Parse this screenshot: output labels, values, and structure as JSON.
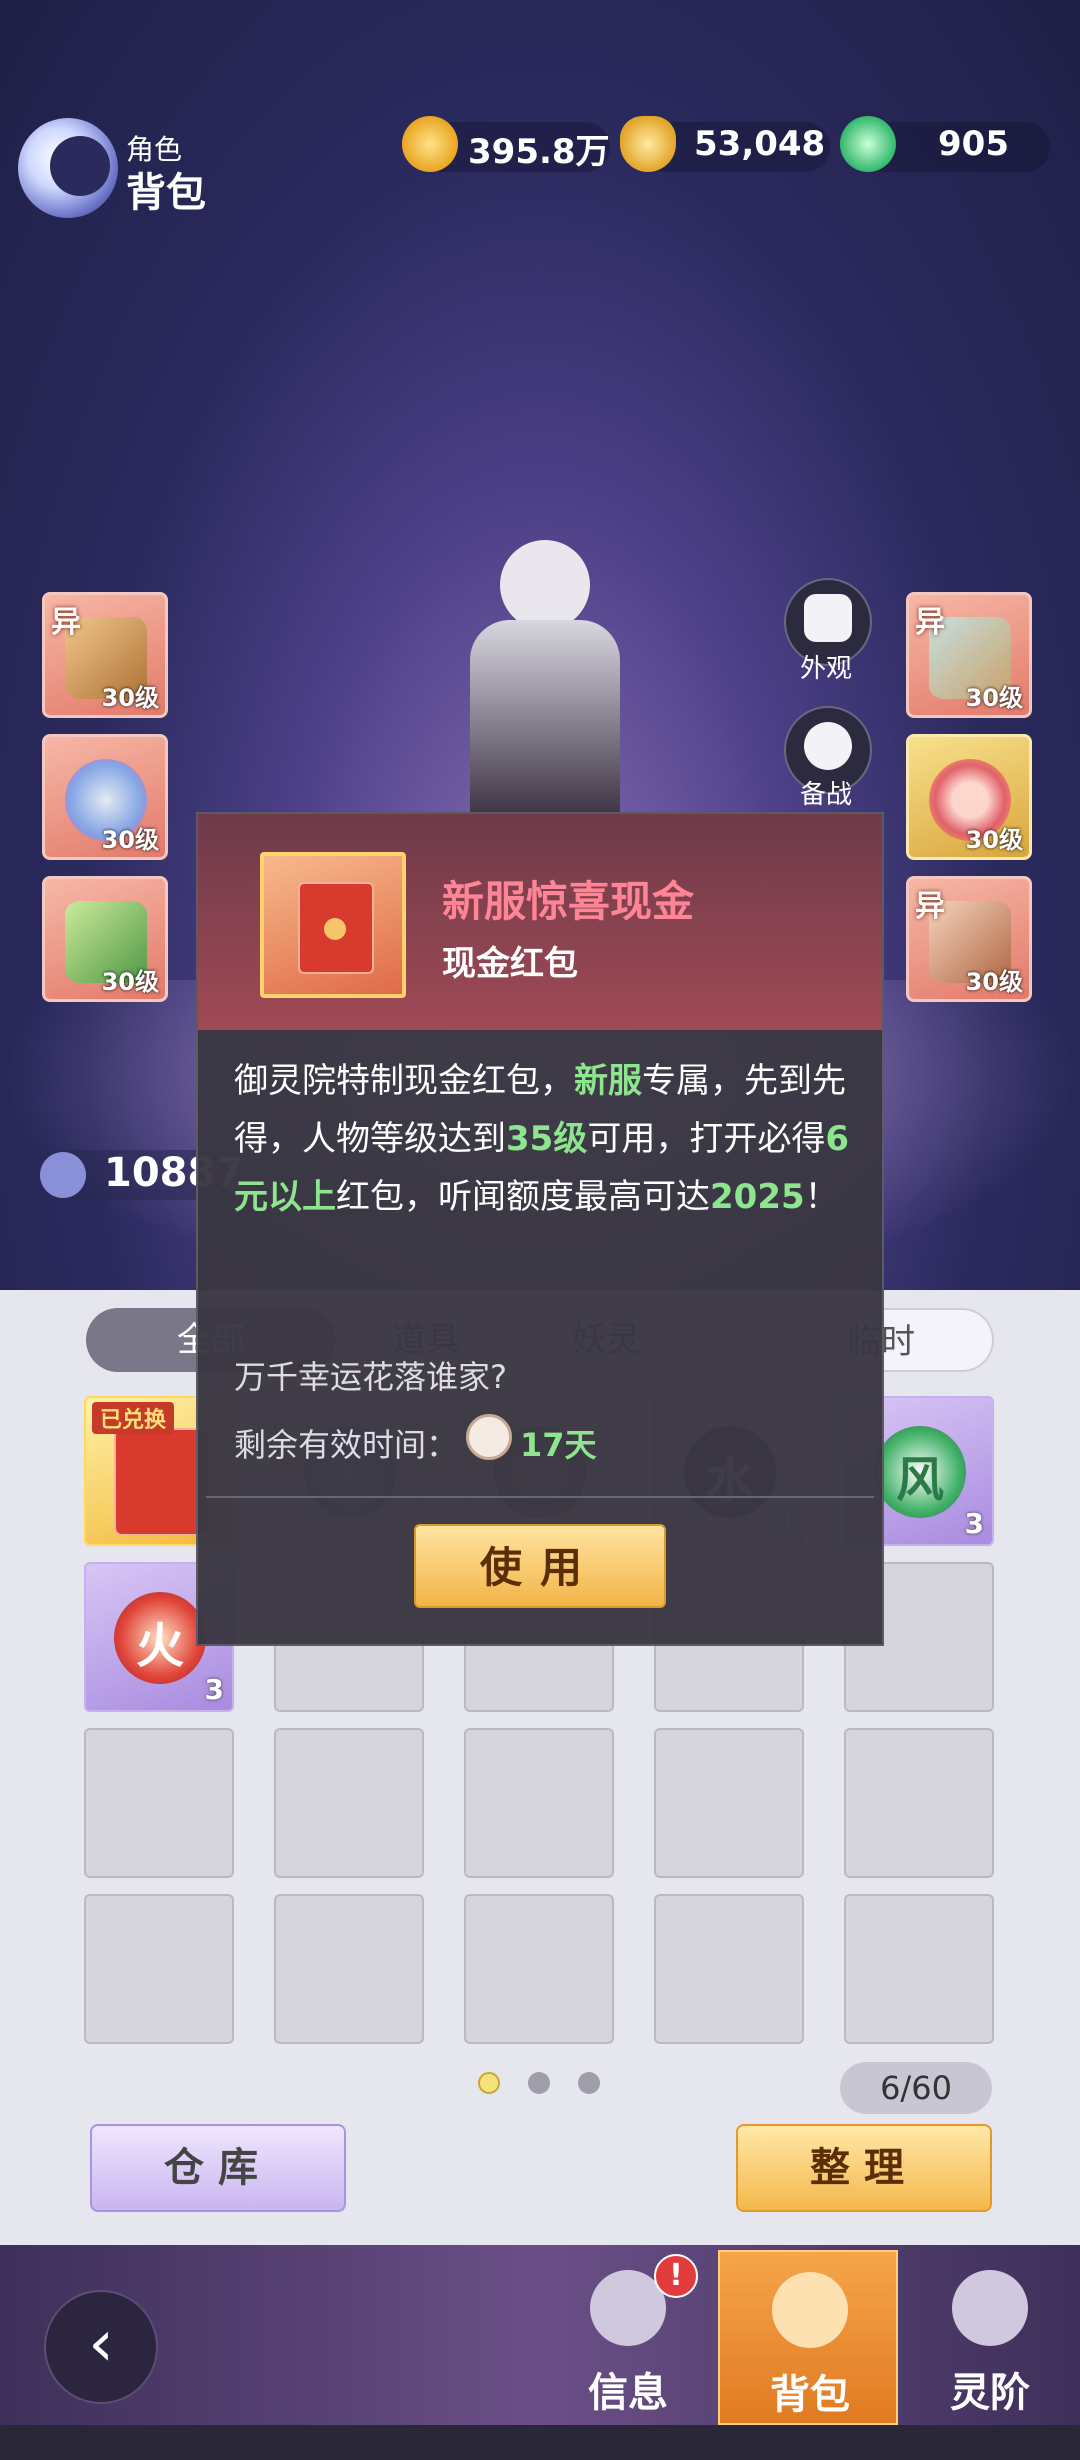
{
  "header": {
    "small_label": "角色",
    "title": "背包"
  },
  "currencies": [
    {
      "icon": "copper-coin-icon",
      "value": "395.8万"
    },
    {
      "icon": "gold-ingot-icon",
      "value": "53,048"
    },
    {
      "icon": "jade-icon",
      "value": "905"
    }
  ],
  "equipment": {
    "left": [
      {
        "tag": "异",
        "level": "30级",
        "icon": "sword-icon"
      },
      {
        "tag": "",
        "level": "30级",
        "icon": "orb-pendant-icon"
      },
      {
        "tag": "",
        "level": "30级",
        "icon": "bamboo-flute-icon"
      }
    ],
    "right": [
      {
        "tag": "异",
        "level": "30级",
        "icon": "armor-icon"
      },
      {
        "tag": "",
        "level": "30级",
        "icon": "ring-icon"
      },
      {
        "tag": "异",
        "level": "30级",
        "icon": "boots-icon"
      }
    ]
  },
  "side_buttons": {
    "appearance": "外观",
    "battle": "备战"
  },
  "power_value": "10887",
  "tabs": [
    {
      "label": "全部",
      "active": true
    },
    {
      "label": "道具",
      "active": false
    },
    {
      "label": "妖灵",
      "active": false
    },
    {
      "label": "临时",
      "active": false
    }
  ],
  "grid": {
    "row1": [
      {
        "badge": "已兑换",
        "type": "red-envelope",
        "count": ""
      },
      {
        "type": "orb",
        "count": ""
      },
      {
        "type": "orb",
        "count": ""
      },
      {
        "type": "orb",
        "glyph": "水",
        "count": "3"
      },
      {
        "type": "orb",
        "glyph": "风",
        "count": "3"
      }
    ],
    "row2": [
      {
        "type": "orb",
        "glyph": "火",
        "count": "3"
      }
    ]
  },
  "pagination": {
    "count": "6/60",
    "pages": 3,
    "current": 1
  },
  "buttons": {
    "warehouse": "仓库",
    "sort": "整理"
  },
  "nav": {
    "items": [
      {
        "label": "信息",
        "icon": "fist-icon"
      },
      {
        "label": "背包",
        "icon": "bag-icon"
      },
      {
        "label": "灵阶",
        "icon": "flame-icon"
      }
    ],
    "badge": "!"
  },
  "popup": {
    "title": "新服惊喜现金",
    "subtitle": "现金红包",
    "desc_parts": [
      {
        "text": "御灵院特制现金红包，",
        "hl": false
      },
      {
        "text": "新服",
        "hl": true
      },
      {
        "text": "专属，先到先得，人物等级达到",
        "hl": false
      },
      {
        "text": "35级",
        "hl": true
      },
      {
        "text": "可用，打开必得",
        "hl": false
      },
      {
        "text": "6元以上",
        "hl": true
      },
      {
        "text": "红包，听闻额度最高可达",
        "hl": false
      },
      {
        "text": "2025",
        "hl": true
      },
      {
        "text": "！",
        "hl": false
      }
    ],
    "flavor": "万千幸运花落谁家?",
    "time_label": "剩余有效时间：",
    "time_value": "17天",
    "use_button": "使用"
  },
  "colors": {
    "highlight": "#8de58d",
    "title": "#ff8596",
    "accent_gold": "#f2b448"
  }
}
